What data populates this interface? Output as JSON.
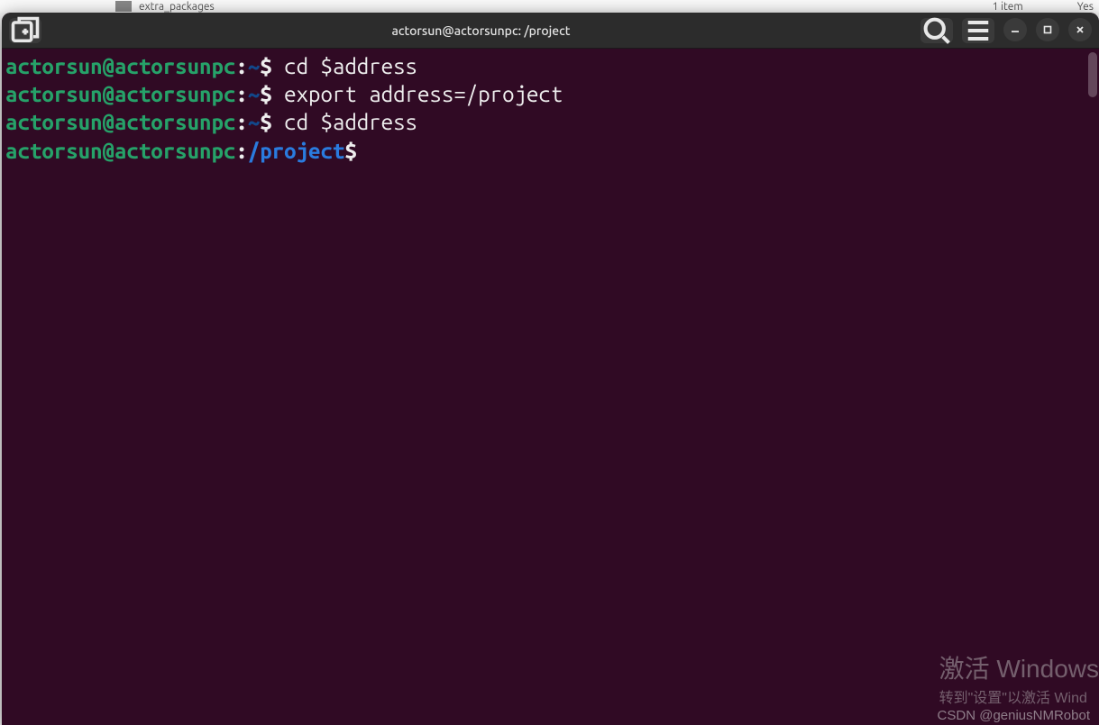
{
  "background": {
    "file_name": "extra_packages",
    "item_count": "1 item",
    "yes": "Yes"
  },
  "titlebar": {
    "title": "actorsun@actorsunpc: /project"
  },
  "terminal": {
    "lines": [
      {
        "user_host": "actorsun@actorsunpc",
        "path": "~",
        "path_class": "path-home",
        "command": "cd $address"
      },
      {
        "user_host": "actorsun@actorsunpc",
        "path": "~",
        "path_class": "path-home",
        "command": "export address=/project"
      },
      {
        "user_host": "actorsun@actorsunpc",
        "path": "~",
        "path_class": "path-home",
        "command": "cd $address"
      },
      {
        "user_host": "actorsun@actorsunpc",
        "path": "/project",
        "path_class": "path-dir",
        "command": ""
      }
    ]
  },
  "watermark": {
    "line1": "激活 Windows",
    "line2": "转到\"设置\"以激活 Wind"
  },
  "csdn": "CSDN @geniusNMRobot",
  "icons": {
    "new_tab": "new-tab-icon",
    "search": "search-icon",
    "menu": "hamburger-icon",
    "minimize": "minimize-icon",
    "maximize": "maximize-icon",
    "close": "close-icon"
  }
}
